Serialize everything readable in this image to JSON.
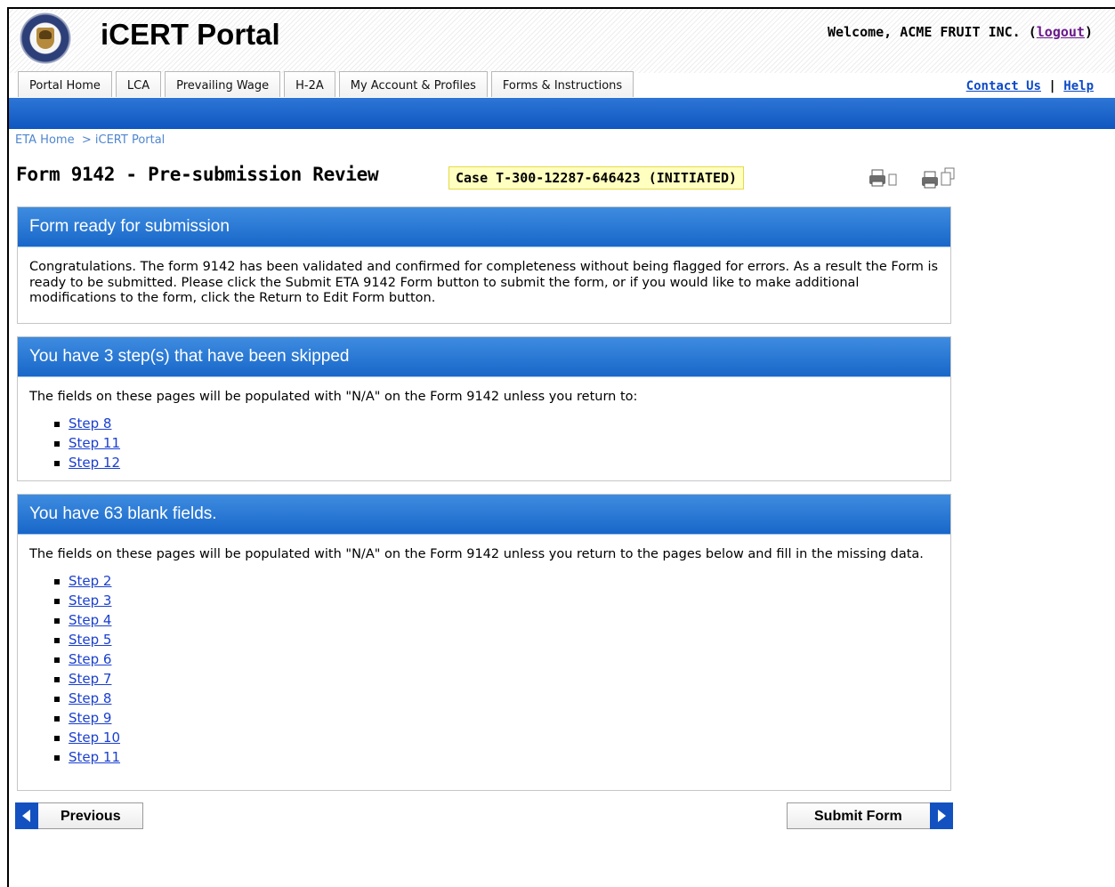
{
  "app": {
    "title": "iCERT Portal",
    "welcome_prefix": "Welcome, ACME FRUIT INC. (",
    "logout_label": "logout",
    "welcome_suffix": ")"
  },
  "nav": {
    "tabs": [
      {
        "label": "Portal Home"
      },
      {
        "label": "LCA"
      },
      {
        "label": "Prevailing Wage"
      },
      {
        "label": "H-2A"
      },
      {
        "label": "My Account & Profiles"
      },
      {
        "label": "Forms & Instructions"
      }
    ],
    "contact_label": "Contact Us",
    "separator": "|",
    "help_label": "Help"
  },
  "breadcrumb": {
    "home_label": "ETA Home",
    "separator": ">",
    "current_label": "iCERT Portal"
  },
  "page": {
    "title": "Form 9142 - Pre-submission Review",
    "case_badge": "Case T-300-12287-646423 (INITIATED)"
  },
  "panels": {
    "ready": {
      "heading": "Form ready for submission",
      "body": "Congratulations. The form 9142 has been validated and confirmed for completeness without being flagged for errors. As a result the Form is ready to be submitted. Please click the Submit ETA 9142 Form button to submit the form, or if you would like to make additional modifications to the form, click the Return to Edit Form button."
    },
    "skipped": {
      "heading": "You have 3 step(s) that have been skipped",
      "body": "The fields on these pages will be populated with \"N/A\" on the Form 9142 unless you return to:",
      "steps": [
        "Step 8",
        "Step 11",
        "Step 12"
      ]
    },
    "blank": {
      "heading": "You have 63 blank fields.",
      "body": "The fields on these pages will be populated with \"N/A\" on the Form 9142 unless you return to the pages below and fill in the missing data.",
      "steps": [
        "Step 2",
        "Step 3",
        "Step 4",
        "Step 5",
        "Step 6",
        "Step 7",
        "Step 8",
        "Step 9",
        "Step 10",
        "Step 11"
      ]
    }
  },
  "buttons": {
    "previous_label": "Previous",
    "submit_label": "Submit Form"
  },
  "colors": {
    "header_blue": "#1867c9",
    "link_blue": "#1a3fd0",
    "badge_yellow": "#ffffc0"
  },
  "icons": [
    "seal-logo",
    "print-icon",
    "print-all-icon",
    "arrow-left-icon",
    "arrow-right-icon"
  ]
}
